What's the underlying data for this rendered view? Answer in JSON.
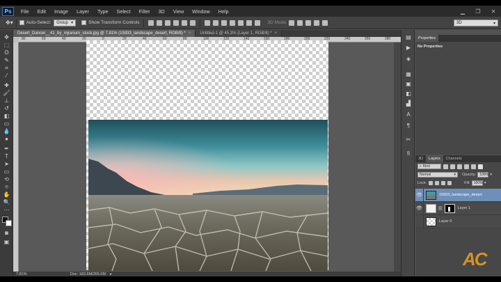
{
  "menu": {
    "logo": "Ps",
    "items": [
      "File",
      "Edit",
      "Image",
      "Layer",
      "Type",
      "Select",
      "Filter",
      "3D",
      "View",
      "Window",
      "Help"
    ]
  },
  "options": {
    "auto_select_label": "Auto-Select:",
    "auto_select_value": "Group",
    "transform_label": "Show Transform Controls",
    "mode_3d_label": "3D Mode:",
    "workspace_value": "3D"
  },
  "tabs": [
    {
      "label": "Desert_Dancer__41_by_mjranum_stock.jpg @ 7.81% (15933_landscape_desert, RGB/8) *",
      "close": "×"
    },
    {
      "label": "Untitled-1 @ 45.3% (Layer 1, RGB/8) *",
      "close": "×"
    }
  ],
  "ruler_h": [
    "80",
    "60",
    "40",
    "20",
    "0",
    "20",
    "40",
    "60",
    "80",
    "100",
    "120",
    "140",
    "160",
    "180",
    "200",
    "220",
    "240",
    "260",
    "280"
  ],
  "status": {
    "zoom": "7.81%",
    "doc": "Doc: 182.6M/265.0M"
  },
  "properties": {
    "tab": "Properties",
    "message": "No Properties"
  },
  "layers_panel": {
    "tabs": [
      "3D",
      "Layers",
      "Channels"
    ],
    "kind_label": "Kind",
    "blend_mode": "Normal",
    "opacity_label": "Opacity:",
    "opacity_value": "100%",
    "lock_label": "Lock:",
    "fill_label": "Fill:",
    "fill_value": "100%",
    "layers": [
      {
        "name": "15933_landscape_desert",
        "visible": true,
        "selected": true
      },
      {
        "name": "Layer 1",
        "visible": true,
        "selected": false
      },
      {
        "name": "Layer 0",
        "visible": false,
        "selected": false
      }
    ]
  },
  "watermark": "AC",
  "colors": {
    "menubar": "#2b2b2b",
    "panel": "#474747",
    "selection": "#6d8fb8",
    "watermark": "#f0a020"
  }
}
